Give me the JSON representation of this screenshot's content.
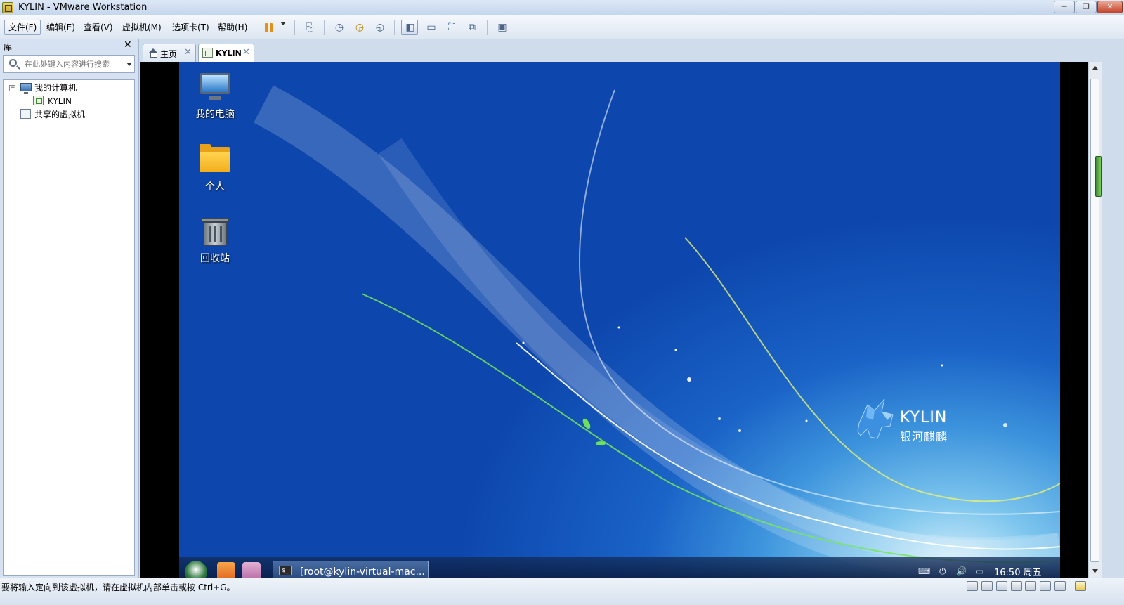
{
  "window": {
    "title": "KYLIN - VMware Workstation",
    "min_label": "─",
    "max_label": "❐",
    "close_label": "✕"
  },
  "menu": {
    "file": "文件(F)",
    "edit": "编辑(E)",
    "view": "查看(V)",
    "vm": "虚拟机(M)",
    "tabs": "选项卡(T)",
    "help": "帮助(H)"
  },
  "toolbar_icons": [
    "pause-icon",
    "dropdown-icon",
    "send-ctrl-alt-del-icon",
    "snapshot-take-icon",
    "snapshot-revert-icon",
    "snapshot-manager-icon",
    "library-view-icon",
    "thumbnail-view-icon",
    "fullscreen-icon",
    "unity-icon",
    "console-view-icon"
  ],
  "library": {
    "title": "库",
    "close": "✕",
    "search_placeholder": "在此处键入内容进行搜索",
    "tree": {
      "my_computer": "我的计算机",
      "vm_name": "KYLIN",
      "shared": "共享的虚拟机",
      "expander": "−"
    }
  },
  "tabs": [
    {
      "label": "主页",
      "close": "✕"
    },
    {
      "label": "KYLIN",
      "close": "✕"
    }
  ],
  "guest": {
    "desktop_icons": [
      {
        "label": "我的电脑",
        "icon": "computer-icon"
      },
      {
        "label": "个人",
        "icon": "home-folder-icon"
      },
      {
        "label": "回收站",
        "icon": "trash-icon"
      }
    ],
    "logo_en": "KYLIN",
    "logo_cn": "银河麒麟",
    "taskbar": {
      "window_label": "[root@kylin-virtual-mac...",
      "terminal_glyph": "$_",
      "clock": "16:50 周五"
    }
  },
  "status": {
    "message": "要将输入定向到该虚拟机，请在虚拟机内部单击或按 Ctrl+G。"
  },
  "colors": {
    "accent": "#1a63c7",
    "pause": "#e48f16"
  }
}
